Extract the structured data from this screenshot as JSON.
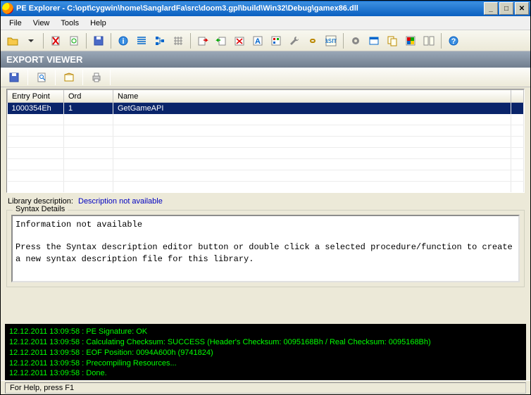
{
  "window": {
    "title": "PE Explorer - C:\\opt\\cygwin\\home\\SanglardFa\\src\\doom3.gpl\\build\\Win32\\Debug\\gamex86.dll"
  },
  "menu": {
    "file": "File",
    "view": "View",
    "tools": "Tools",
    "help": "Help"
  },
  "panel": {
    "title": "EXPORT VIEWER"
  },
  "table": {
    "headers": {
      "entry": "Entry Point",
      "ord": "Ord",
      "name": "Name"
    },
    "rows": [
      {
        "entry": "1000354Eh",
        "ord": "1",
        "name": "GetGameAPI"
      }
    ]
  },
  "libdesc": {
    "label": "Library description:",
    "value": "Description not available"
  },
  "syntax": {
    "legend": "Syntax Details",
    "body": "Information not available\n\nPress the Syntax description editor button or double click a selected procedure/function to create a new syntax description file for this library."
  },
  "console": [
    "12.12.2011 13:09:58 : PE Signature: OK",
    "12.12.2011 13:09:58 : Calculating Checksum: SUCCESS (Header's Checksum: 0095168Bh / Real Checksum: 0095168Bh)",
    "12.12.2011 13:09:58 : EOF Position: 0094A600h  (9741824)",
    "12.12.2011 13:09:58 : Precompiling Resources...",
    "12.12.2011 13:09:58 : Done."
  ],
  "status": {
    "text": "For Help, press F1"
  }
}
